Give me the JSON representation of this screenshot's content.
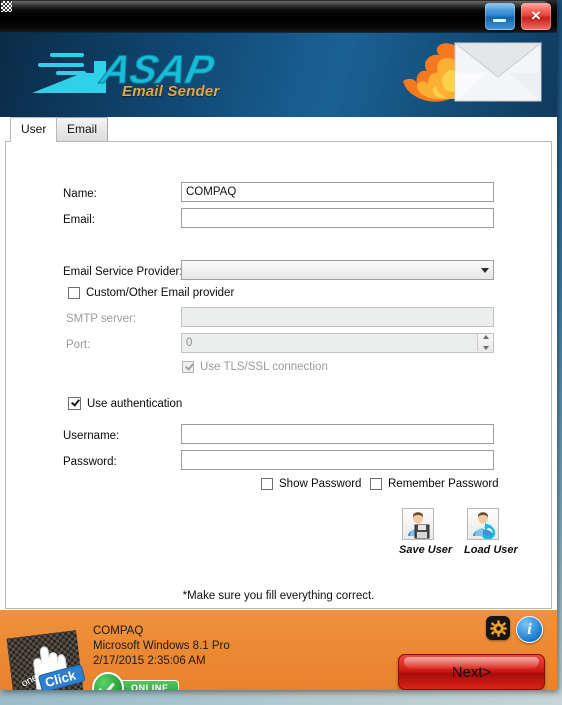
{
  "window": {
    "minimize_label": "Minimize",
    "close_label": "×"
  },
  "header": {
    "logo_text": "ASAP",
    "logo_subtitle": "Email Sender",
    "mail_icon": "flaming-envelope-icon"
  },
  "tabs": [
    {
      "label": "User",
      "active": true
    },
    {
      "label": "Email",
      "active": false
    }
  ],
  "form": {
    "name": {
      "label": "Name:",
      "value": "COMPAQ"
    },
    "email": {
      "label": "Email:",
      "value": ""
    },
    "provider": {
      "label": "Email Service Provider:",
      "value": ""
    },
    "custom_provider": {
      "label": "Custom/Other Email provider",
      "checked": false
    },
    "smtp": {
      "label": "SMTP server:",
      "value": "",
      "disabled": true
    },
    "port": {
      "label": "Port:",
      "value": "0",
      "disabled": true
    },
    "tls": {
      "label": "Use TLS/SSL connection",
      "checked": true,
      "disabled": true
    },
    "use_auth": {
      "label": "Use authentication",
      "checked": true
    },
    "username": {
      "label": "Username:",
      "value": ""
    },
    "password": {
      "label": "Password:",
      "value": ""
    },
    "show_password": {
      "label": "Show Password",
      "checked": false
    },
    "remember_password": {
      "label": "Remember Password",
      "checked": false
    },
    "save_user": {
      "label": "Save User",
      "icon": "save-user-icon"
    },
    "load_user": {
      "label": "Load User",
      "icon": "load-user-icon"
    },
    "hint": "*Make sure you fill everything correct."
  },
  "footer": {
    "logo": "one-click-logo",
    "computer_name": "COMPAQ",
    "os": "Microsoft Windows 8.1 Pro",
    "datetime": "2/17/2015 2:35:06 AM",
    "status": "ONLINE",
    "gear_icon": "gear-icon",
    "info_icon": "info-icon",
    "next_label": "Next>"
  },
  "colors": {
    "header_blue": "#0b2f4d",
    "accent_orange": "#e8812c",
    "logo_cyan": "#2fd0e8",
    "logo_gold": "#e8a33d",
    "next_red": "#d21a12",
    "online_green": "#2da23c"
  }
}
